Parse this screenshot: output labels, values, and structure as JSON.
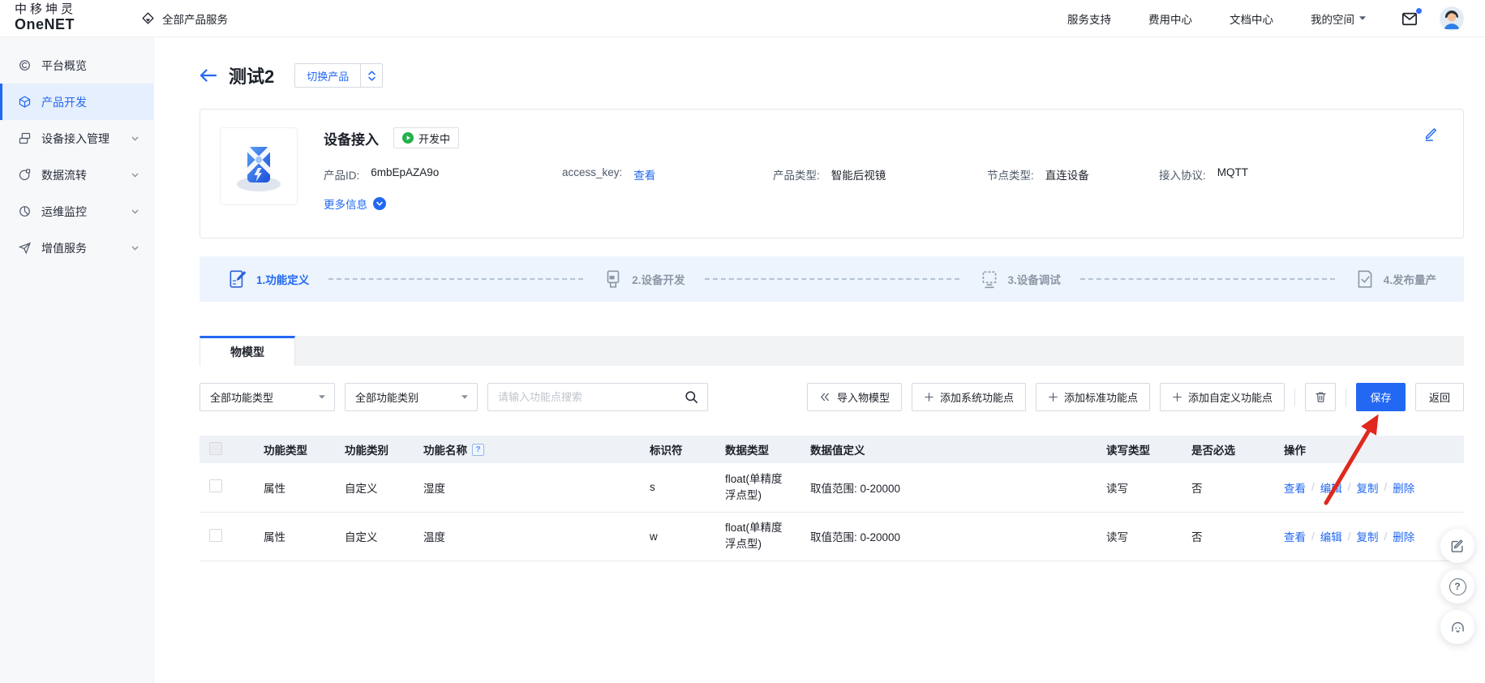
{
  "topbar": {
    "logo_line1": "中移坤灵",
    "logo_line2": "OneNET",
    "all_products": "全部产品服务",
    "nav": [
      {
        "label": "服务支持"
      },
      {
        "label": "费用中心"
      },
      {
        "label": "文档中心"
      },
      {
        "label": "我的空间"
      }
    ]
  },
  "sidebar": {
    "items": [
      {
        "label": "平台概览"
      },
      {
        "label": "产品开发"
      },
      {
        "label": "设备接入管理"
      },
      {
        "label": "数据流转"
      },
      {
        "label": "运维监控"
      },
      {
        "label": "增值服务"
      }
    ]
  },
  "page": {
    "title": "测试2",
    "switch_product_label": "切换产品"
  },
  "product": {
    "name": "设备接入",
    "status": "开发中",
    "fields": [
      {
        "label": "产品ID:",
        "value": "6mbEpAZA9o"
      },
      {
        "label": "access_key:",
        "value": "查看"
      },
      {
        "label": "产品类型:",
        "value": "智能后视镜"
      },
      {
        "label": "节点类型:",
        "value": "直连设备"
      },
      {
        "label": "接入协议:",
        "value": "MQTT"
      }
    ],
    "more_info": "更多信息"
  },
  "steps": [
    {
      "label": "1.功能定义"
    },
    {
      "label": "2.设备开发"
    },
    {
      "label": "3.设备调试"
    },
    {
      "label": "4.发布量产"
    }
  ],
  "tabs": {
    "model_tab": "物模型"
  },
  "toolbar": {
    "type_filter": "全部功能类型",
    "category_filter": "全部功能类别",
    "search_placeholder": "请输入功能点搜索",
    "import_label": "导入物模型",
    "add_system_label": "添加系统功能点",
    "add_standard_label": "添加标准功能点",
    "add_custom_label": "添加自定义功能点",
    "save_label": "保存",
    "back_label": "返回"
  },
  "table": {
    "headers": [
      "功能类型",
      "功能类别",
      "功能名称",
      "标识符",
      "数据类型",
      "数据值定义",
      "读写类型",
      "是否必选",
      "操作"
    ],
    "name_help": "?",
    "action_separator": "/",
    "actions": [
      "查看",
      "编辑",
      "复制",
      "删除"
    ],
    "rows": [
      {
        "func_type": "属性",
        "category": "自定义",
        "name": "湿度",
        "identifier": "s",
        "data_type": "float(单精度浮点型)",
        "value_def": "取值范围: 0-20000",
        "rw": "读写",
        "required": "否"
      },
      {
        "func_type": "属性",
        "category": "自定义",
        "name": "温度",
        "identifier": "w",
        "data_type": "float(单精度浮点型)",
        "value_def": "取值范围: 0-20000",
        "rw": "读写",
        "required": "否"
      }
    ]
  },
  "floating": {
    "help_glyph": "?"
  },
  "colors": {
    "primary_blue": "#2268f2",
    "status_green": "#23b14d",
    "arrow_red": "#e0281e",
    "steps_bg": "#edf4fe"
  }
}
